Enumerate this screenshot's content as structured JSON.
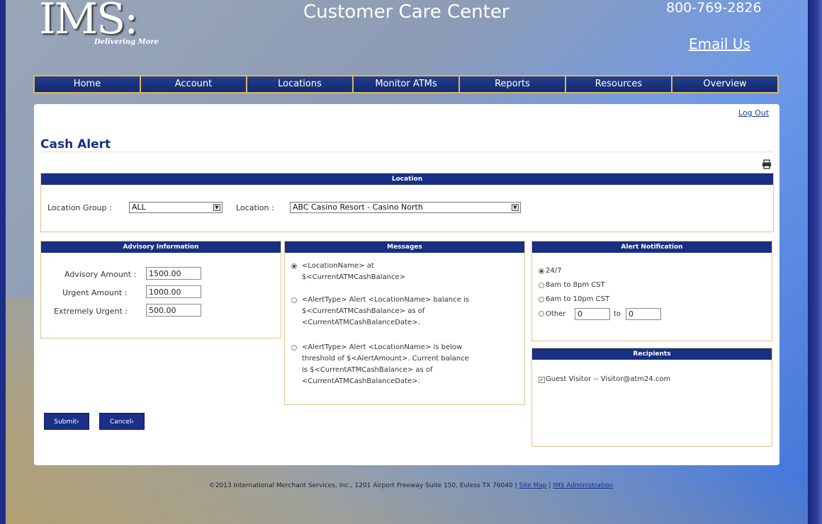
{
  "header": {
    "logo_text": "IMS:",
    "logo_tagline": "Delivering More",
    "site_title": "Customer Care Center",
    "phone": "800-769-2826",
    "email_label": "Email Us"
  },
  "nav": [
    "Home",
    "Account",
    "Locations",
    "Monitor ATMs",
    "Reports",
    "Resources",
    "Overview"
  ],
  "logout_label": "Log Out",
  "page_title": "Cash Alert",
  "location_panel": {
    "title": "Location",
    "group_label": "Location Group :",
    "group_value": "ALL",
    "location_label": "Location :",
    "location_value": "ABC Casino Resort - Casino North"
  },
  "advisory_panel": {
    "title": "Advisory Information",
    "advisory_label": "Advisory Amount :",
    "advisory_value": "1500.00",
    "urgent_label": "Urgent Amount :",
    "urgent_value": "1000.00",
    "extreme_label": "Extremely Urgent :",
    "extreme_value": "500.00"
  },
  "messages_panel": {
    "title": "Messages",
    "options": [
      {
        "line1": "<LocationName> at",
        "line2": "$<CurrentATMCashBalance>",
        "line3": "",
        "line4": ""
      },
      {
        "line1": "<AlertType> Alert <LocationName> balance is",
        "line2": "$<CurrentATMCashBalance> as of",
        "line3": "<CurrentATMCashBalanceDate>.",
        "line4": ""
      },
      {
        "line1": "<AlertType> Alert <LocationName> is below",
        "line2": "threshold of $<AlertAmount>. Current balance",
        "line3": "is $<CurrentATMCashBalance> as of",
        "line4": "<CurrentATMCashBalanceDate>."
      }
    ],
    "selected_index": 0
  },
  "notification_panel": {
    "title": "Alert Notification",
    "options": [
      "24/7",
      "8am to 8pm CST",
      "6am to 10pm CST",
      "Other"
    ],
    "selected_index": 0,
    "other_from": "0",
    "other_to_label": "to",
    "other_to": "0"
  },
  "recipients_panel": {
    "title": "Recipients",
    "recipient": "Guest Visitor -- Visitor@atm24.com",
    "checked": true
  },
  "buttons": {
    "submit": "Submit›",
    "cancel": "Cancel›"
  },
  "footer": {
    "text": "©2013 International Merchant Services, Inc., 1201 Airport Freeway Suite 150, Euless TX 76040 | ",
    "sitemap": "Site Map",
    "separator": " | ",
    "admin": "IMS Administration"
  },
  "colors": {
    "nav_blue": "#182f84",
    "gold_border": "#d8b860"
  }
}
